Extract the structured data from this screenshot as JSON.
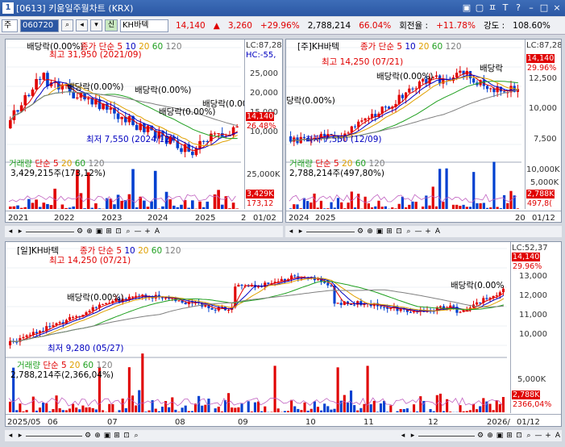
{
  "window": {
    "id": "[0613]",
    "title": "키움일주월차트 (KRX)",
    "controls": [
      "▣",
      "▢",
      "ㅍ",
      "T",
      "?",
      "–",
      "□",
      "×"
    ]
  },
  "toolbar": {
    "mode": "주",
    "code": "060720",
    "credit": "신",
    "name": "KH바텍",
    "price": "14,140",
    "change": "3,260",
    "change_pct": "+29.96%",
    "volume": "2,788,214",
    "vol_ratio": "66.04%",
    "turnover_label": "회전율 :",
    "turnover": "+11.78%",
    "strength_label": "강도 :",
    "strength": "108.60%"
  },
  "panels": {
    "monthly": {
      "legend": {
        "ma": "종가 단순 5",
        "p10": "10",
        "p20": "20",
        "p60": "60",
        "p120": "120"
      },
      "lc": "LC:87,28",
      "hc": "HC:-55,",
      "high_note": "최고 31,950 (2021/09)",
      "low_note": "최저 7,550 (2024/12)",
      "div_note": "배당락(0.00%)",
      "y_ticks": [
        "25,000",
        "20,000",
        "15,000",
        "10,000"
      ],
      "price_tag": "14,140",
      "pct_tag": "26.48%",
      "vol_legend": {
        "name": "거래량",
        "ma": "단순 5",
        "p20": "20",
        "p60": "60",
        "p120": "120"
      },
      "vol_note": "3,429,215주(173,12%)",
      "vol_ticks": [
        "25,000K"
      ],
      "vol_tag": "3,429K",
      "vol_pct_tag": "173,12",
      "x_ticks": [
        "2021",
        "2022",
        "2023",
        "2024",
        "2025",
        "2"
      ],
      "date": "01/02"
    },
    "weekly": {
      "head": "[주]KH바텍",
      "legend": {
        "ma": "종가 단순 5",
        "p10": "10",
        "p20": "20",
        "p60": "60",
        "p120": "120"
      },
      "lc": "LC:87,28",
      "high_note": "최고 14,250 (07/21)",
      "low_note": "최저 7,550 (12/09)",
      "div_note": "배당락(0.00%)",
      "div_note2": "배당락",
      "div_left": "당락(0.00%)",
      "y_ticks": [
        "12,500",
        "10,000",
        "7,500"
      ],
      "price_tag": "14,140",
      "pct_tag": "29.96%",
      "vol_legend": {
        "name": "거래량",
        "ma": "단순 5",
        "p20": "20",
        "p60": "60",
        "p120": "120"
      },
      "vol_note": "2,788,214주(497,80%)",
      "vol_ticks": [
        "10,000K",
        "5,000K"
      ],
      "vol_tag": "2,788K",
      "vol_pct_tag": "497,8(",
      "x_ticks": [
        "2024",
        "2025",
        "20"
      ],
      "date": "01/12"
    },
    "daily": {
      "head": "[일]KH바텍",
      "legend": {
        "ma": "종가 단순 5",
        "p10": "10",
        "p20": "20",
        "p60": "60",
        "p120": "120"
      },
      "lc": "LC:52,37",
      "high_note": "최고 14,250 (07/21)",
      "low_note": "최저 9,280 (05/27)",
      "div_note": "배당락(0.00%)",
      "div_note2": "배당락(0.00%",
      "y_ticks": [
        "13,000",
        "12,000",
        "11,000",
        "10,000"
      ],
      "price_tag": "14,140",
      "pct_tag": "29.96%",
      "vol_legend": {
        "name": "거래량",
        "ma": "단순 5",
        "p20": "20",
        "p60": "60",
        "p120": "120"
      },
      "vol_note": "2,788,214주(2,366,04%)",
      "vol_ticks": [
        "5,000K"
      ],
      "vol_tag": "2,788K",
      "vol_pct_tag": "2366,04%",
      "x_ticks": [
        "2025/05",
        "06",
        "07",
        "08",
        "09",
        "10",
        "11",
        "12",
        "2026/"
      ],
      "date": "01/12"
    }
  },
  "ctrl_icons": [
    "◂",
    "▸",
    "⚙",
    "⊕",
    "▣",
    "⊞",
    "⊡",
    "⌕",
    "—",
    "+",
    "A"
  ],
  "colors": {
    "up": "#e00000",
    "down": "#0040d0",
    "ma5": "#e00000",
    "ma10": "#0000c0",
    "ma20": "#e0a000",
    "ma60": "#20a020",
    "ma120": "#808080",
    "accent": "#2b57a3"
  }
}
